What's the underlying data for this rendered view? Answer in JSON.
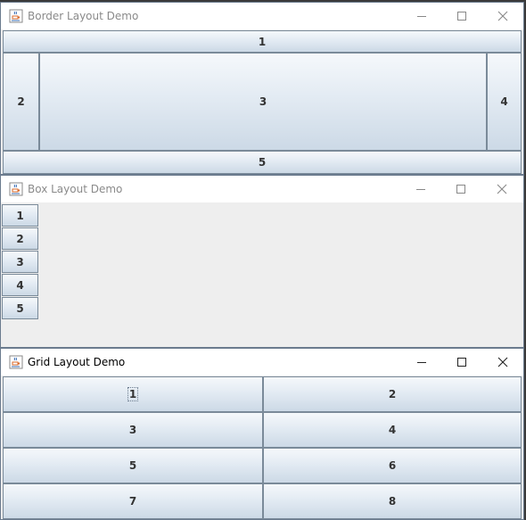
{
  "windows": {
    "border": {
      "title": "Border Layout Demo",
      "buttons": {
        "north": "1",
        "west": "2",
        "center": "3",
        "east": "4",
        "south": "5"
      }
    },
    "box": {
      "title": "Box Layout Demo",
      "buttons": [
        "1",
        "2",
        "3",
        "4",
        "5"
      ]
    },
    "grid": {
      "title": "Grid Layout Demo",
      "buttons": [
        "1",
        "2",
        "3",
        "4",
        "5",
        "6",
        "7",
        "8"
      ]
    }
  },
  "icons": {
    "app": "java-cup-icon",
    "minimize": "minimize-icon",
    "maximize": "maximize-icon",
    "close": "close-icon"
  },
  "colors": {
    "titlebar_bg": "#ffffff",
    "inactive_title": "#8a8a8a",
    "active_title": "#000000",
    "content_bg": "#eeeeee",
    "button_border": "#7a8a99"
  }
}
